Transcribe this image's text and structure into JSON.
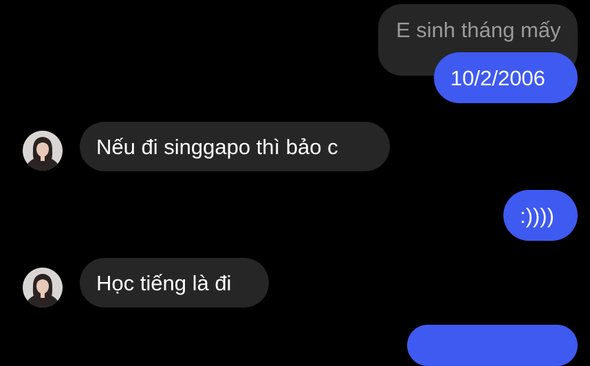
{
  "conversation": {
    "reply_quote": "E sinh tháng mấy",
    "messages": [
      {
        "direction": "outgoing",
        "text": "10/2/2006"
      },
      {
        "direction": "incoming",
        "text": "Nếu đi singgapo thì bảo c"
      },
      {
        "direction": "outgoing",
        "text": ":))))"
      },
      {
        "direction": "incoming",
        "text": "Học tiếng là đi"
      }
    ]
  },
  "colors": {
    "background": "#000000",
    "outgoing_bubble": "#3f5af0",
    "incoming_bubble": "#262626",
    "quoted_text": "#9a9a9a"
  }
}
